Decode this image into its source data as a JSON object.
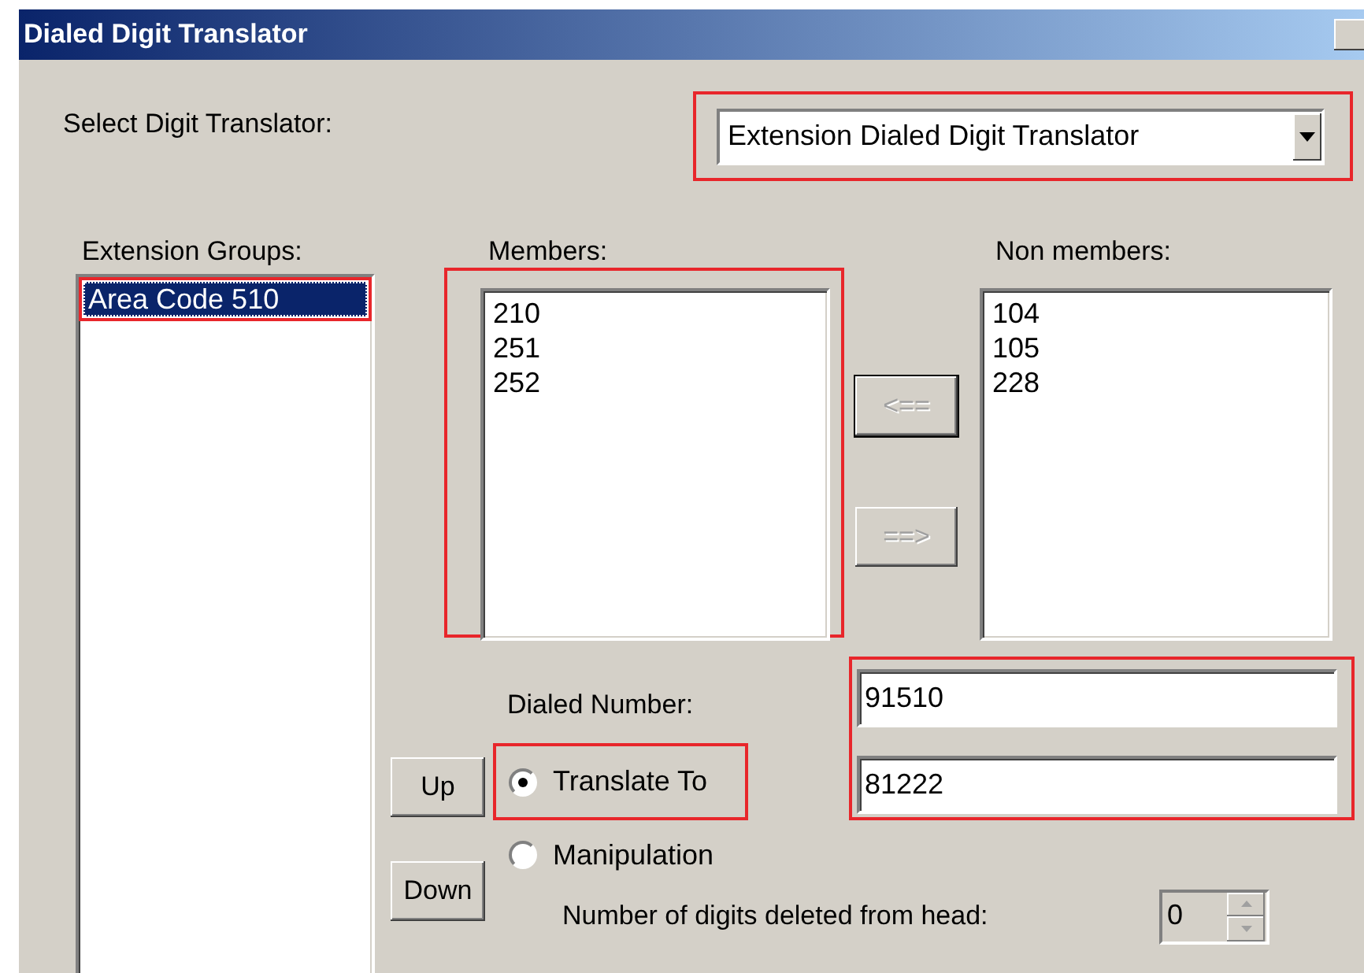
{
  "window": {
    "title": "Dialed Digit Translator"
  },
  "translator_select": {
    "label": "Select Digit Translator:",
    "value": "Extension Dialed Digit Translator",
    "highlighted": true
  },
  "extension_groups": {
    "label": "Extension Groups:",
    "items": [
      {
        "label": "Area Code 510",
        "selected": true,
        "highlighted": true
      }
    ]
  },
  "members": {
    "label": "Members:",
    "highlighted": true,
    "items": [
      {
        "label": "210",
        "selected": false
      },
      {
        "label": "251",
        "selected": false
      },
      {
        "label": "252",
        "selected": false
      }
    ]
  },
  "move_buttons": [
    {
      "label": "<==",
      "disabled": true,
      "default": true
    },
    {
      "label": "==>",
      "disabled": true,
      "default": false
    }
  ],
  "non_members": {
    "label": "Non members:",
    "items": [
      {
        "label": "104",
        "selected": false
      },
      {
        "label": "105",
        "selected": false
      },
      {
        "label": "228",
        "selected": false
      }
    ]
  },
  "order_buttons": [
    {
      "label": "Up"
    },
    {
      "label": "Down"
    }
  ],
  "translation": {
    "fields_highlighted": true,
    "dialed_number": {
      "label": "Dialed Number:",
      "value": "91510"
    },
    "translate_to": {
      "label": "Translate To",
      "selected": true,
      "highlighted": true,
      "value": "81222"
    },
    "manipulation": {
      "label": "Manipulation",
      "selected": false
    },
    "digits_deleted": {
      "label": "Number of digits deleted from head:",
      "value": "0"
    }
  }
}
